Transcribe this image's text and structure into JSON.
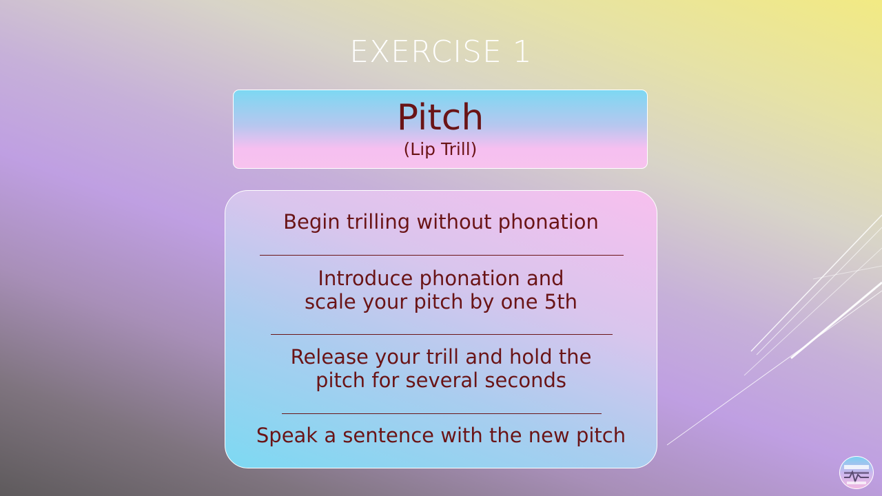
{
  "slide": {
    "title": "EXERCISE 1",
    "header": {
      "main": "Pitch",
      "sub": "(Lip Trill)"
    },
    "steps": [
      "Begin trilling without phonation",
      "Introduce phonation and",
      "scale your pitch by one 5th",
      "Release your trill and hold the",
      "pitch for several seconds",
      "Speak a sentence with the new pitch"
    ]
  },
  "colors": {
    "text_dark_red": "#6a1416",
    "title_white": "#ffffff",
    "accent_blue": "#7dd8f2",
    "accent_pink": "#f7c3ee"
  },
  "icons": {
    "corner_logo": "circular-logo-icon",
    "decoration": "diagonal-lines-decoration"
  }
}
